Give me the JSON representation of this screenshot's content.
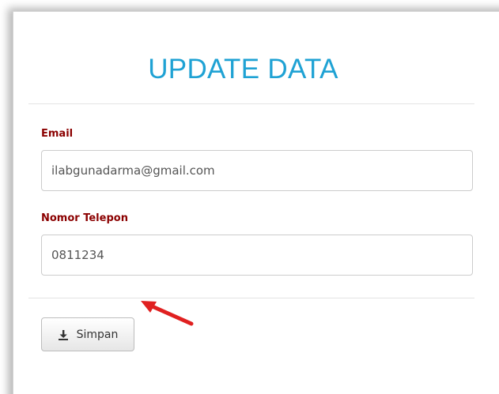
{
  "form": {
    "title": "UPDATE DATA",
    "email_label": "Email",
    "email_value": "ilabgunadarma@gmail.com",
    "phone_label": "Nomor Telepon",
    "phone_value": "0811234",
    "save_label": "Simpan",
    "save_icon": "download-icon"
  },
  "colors": {
    "title": "#1fa2d4",
    "label": "#8b0000",
    "annotation_arrow": "#e02020"
  }
}
